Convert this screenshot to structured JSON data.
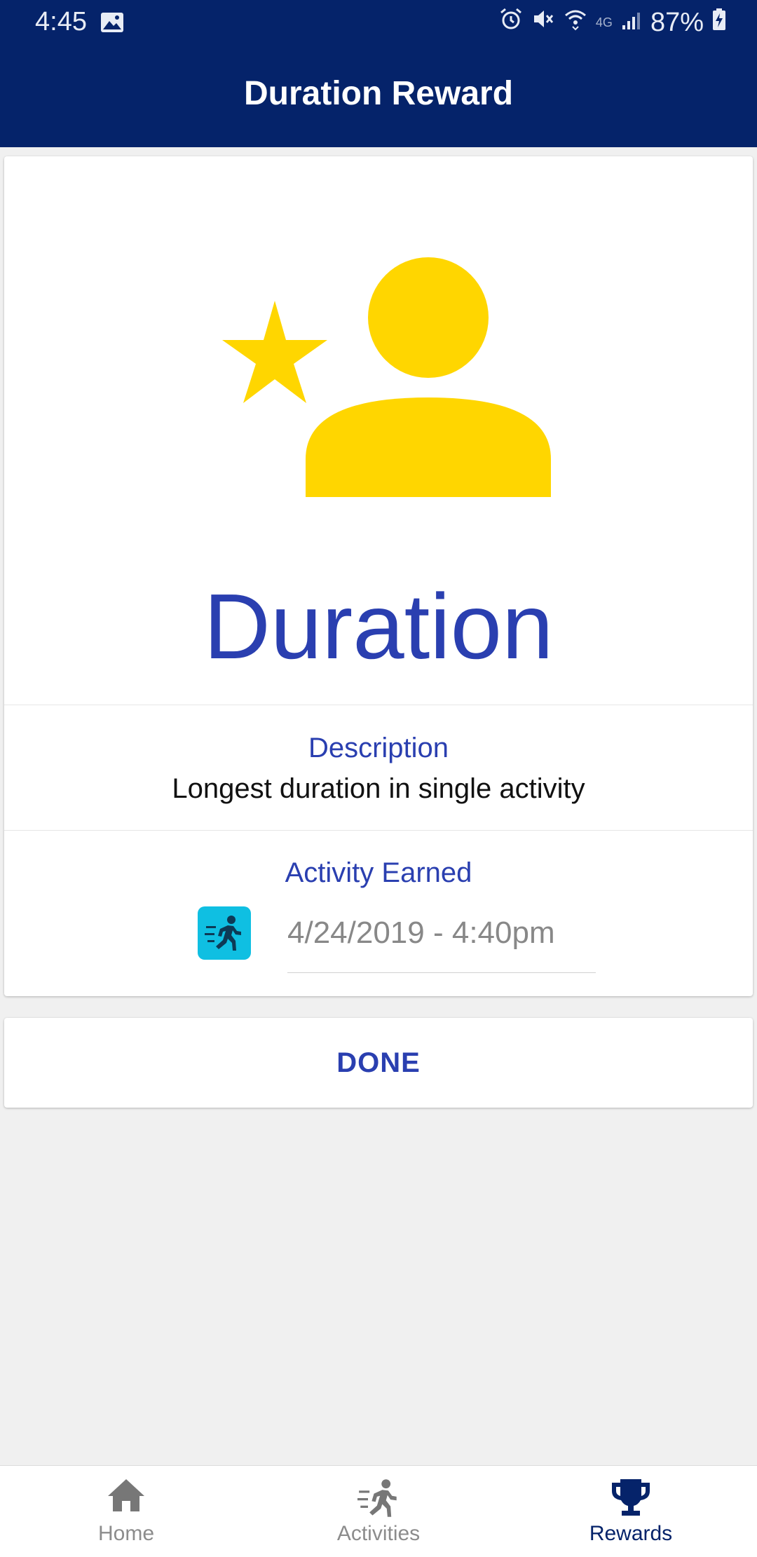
{
  "status_bar": {
    "time": "4:45",
    "network_label": "4G",
    "battery": "87%",
    "icons": [
      "gallery-icon",
      "alarm-icon",
      "mute-icon",
      "wifi-icon",
      "signal-icon",
      "battery-charging-icon"
    ]
  },
  "app_bar": {
    "title": "Duration Reward"
  },
  "reward": {
    "icon": "star-person-icon",
    "icon_color": "#FFD600",
    "name": "Duration",
    "description_label": "Description",
    "description": "Longest duration in single activity",
    "activity_label": "Activity Earned",
    "activity_icon": "running-person-icon",
    "activity_date": "4/24/2019 - 4:40pm"
  },
  "done_button": {
    "label": "DONE"
  },
  "bottom_nav": {
    "items": [
      {
        "label": "Home",
        "icon": "home-icon",
        "active": false
      },
      {
        "label": "Activities",
        "icon": "running-person-icon",
        "active": false
      },
      {
        "label": "Rewards",
        "icon": "trophy-icon",
        "active": true
      }
    ]
  },
  "colors": {
    "app_bar": "#05236A",
    "accent": "#2A3FB0",
    "activity_badge": "#0FBFE2",
    "background": "#F0F0F0"
  }
}
